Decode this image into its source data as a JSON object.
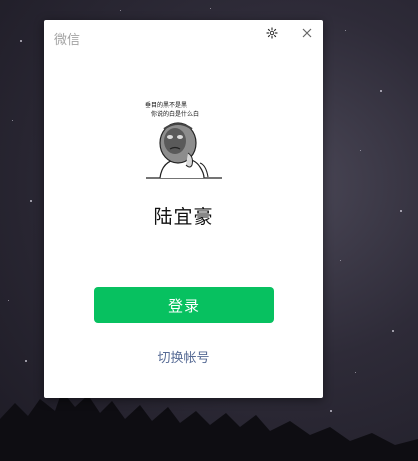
{
  "window": {
    "app_title": "微信",
    "icons": {
      "settings": "gear-icon",
      "close": "close-icon"
    }
  },
  "profile": {
    "avatar_caption_line1": "垂目的黑不是黑",
    "avatar_caption_line2": "你说的白是什么白",
    "user_name": "陆宜豪"
  },
  "actions": {
    "login_label": "登录",
    "switch_account_label": "切换帐号"
  },
  "colors": {
    "login_button": "#07c160",
    "link": "#576b95",
    "title": "#a3a3a3"
  }
}
